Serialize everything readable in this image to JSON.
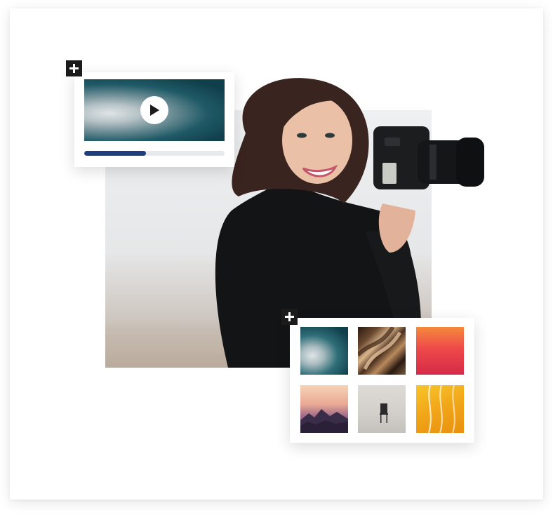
{
  "video_card": {
    "progress": 0.44,
    "accent_color": "#1e3f7a",
    "play_icon": "play-icon",
    "add_icon": "plus-icon"
  },
  "gallery": {
    "add_icon": "plus-icon",
    "thumbnails": [
      {
        "name": "teal-abstract"
      },
      {
        "name": "bronze-metal"
      },
      {
        "name": "red-orange-gradient"
      },
      {
        "name": "purple-mountains"
      },
      {
        "name": "chair-on-white"
      },
      {
        "name": "yellow-waves"
      }
    ]
  },
  "hero": {
    "subject": "photographer-with-camera"
  }
}
